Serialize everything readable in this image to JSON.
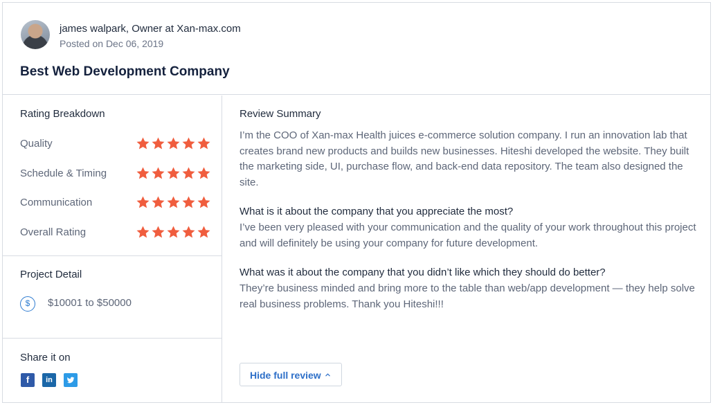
{
  "review": {
    "author": "james walpark, Owner at Xan-max.com",
    "posted": "Posted on Dec 06, 2019",
    "title": "Best Web Development Company"
  },
  "rating_breakdown": {
    "title": "Rating Breakdown",
    "star_color": "#f05d3e",
    "rows": [
      {
        "label": "Quality",
        "stars": 5
      },
      {
        "label": "Schedule & Timing",
        "stars": 5
      },
      {
        "label": "Communication",
        "stars": 5
      },
      {
        "label": "Overall Rating",
        "stars": 5
      }
    ]
  },
  "project_detail": {
    "title": "Project Detail",
    "budget": "$10001 to $50000",
    "budget_icon": "dollar-circle-icon"
  },
  "share": {
    "title": "Share it on",
    "networks": [
      "facebook-icon",
      "linkedin-icon",
      "twitter-icon"
    ]
  },
  "summary": {
    "title": "Review Summary",
    "text": "I’m the COO of Xan-max Health juices e-commerce solution company. I run an innovation lab that creates brand new products and builds new businesses. Hiteshi developed the website. They built the marketing side, UI, purchase flow, and back-end data repository. The team also designed the site.",
    "q1": "What is it about the company that you appreciate the most?",
    "a1": "I’ve been very pleased with your communication and the quality of your work throughout this project and will definitely be using your company for future development.",
    "q2": "What was it about the company that you didn’t like which they should do better?",
    "a2": "They’re business minded and bring more to the table than web/app development — they help solve real business problems. Thank you Hiteshi!!!"
  },
  "actions": {
    "hide_label": "Hide full review"
  }
}
